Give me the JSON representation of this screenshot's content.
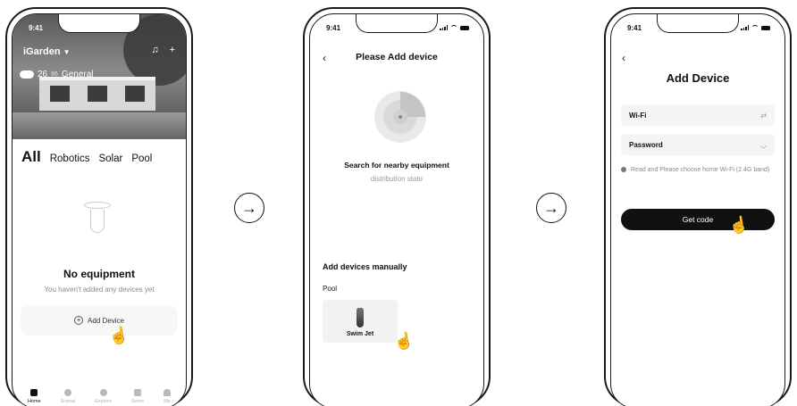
{
  "phone1": {
    "status_time": "9:41",
    "brand": "iGarden",
    "weather_temp": "26",
    "weather_pm": "86",
    "weather_quality": "General",
    "categories": [
      "All",
      "Robotics",
      "Solar",
      "Pool"
    ],
    "empty_title": "No equipment",
    "empty_sub": "You haven't added any devices yet",
    "add_device": "Add Device",
    "tabs": [
      "Home",
      "Scenal",
      "Explore",
      "Serve",
      "Me"
    ]
  },
  "phone2": {
    "status_time": "9:41",
    "title": "Please Add device",
    "search_title": "Search for nearby equipment",
    "search_sub": "distribution state",
    "manual_title": "Add devices manually",
    "group_label": "Pool",
    "device_name": "Swim Jet"
  },
  "phone3": {
    "status_time": "9:41",
    "title": "Add Device",
    "wifi_label": "Wi-Fi",
    "password_label": "Password",
    "hint": "Read and Please choose home Wi-Fi (2.4G band)",
    "button": "Get code"
  },
  "icons": {
    "arrow": "right-arrow-circle",
    "pointer": "hand-pointer"
  }
}
